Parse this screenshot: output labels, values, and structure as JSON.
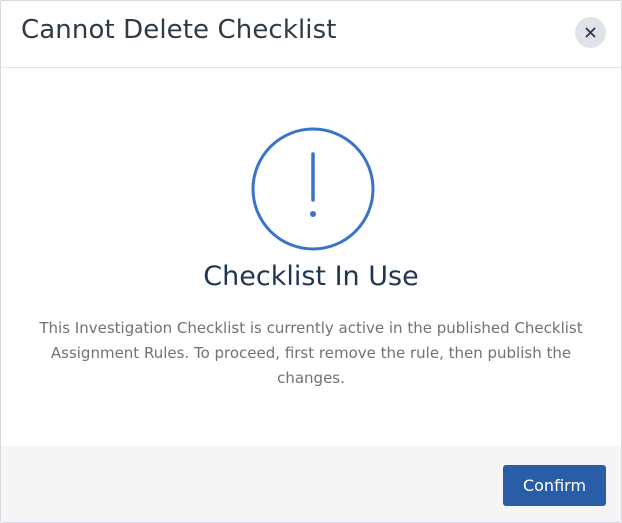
{
  "dialog": {
    "title": "Cannot Delete Checklist",
    "close_icon": "close-icon",
    "warning_icon": "exclamation-circle-icon",
    "heading": "Checklist In Use",
    "message": "This Investigation Checklist is currently active in the published Checklist Assignment Rules. To proceed, first remove the rule, then publish the changes.",
    "confirm_label": "Confirm"
  },
  "colors": {
    "accent": "#2a5da8",
    "icon_stroke": "#3a74c8",
    "heading": "#1e3555",
    "body_text": "#6e7378",
    "footer_bg": "#f5f5f5",
    "close_bg": "#dfe3e8"
  }
}
